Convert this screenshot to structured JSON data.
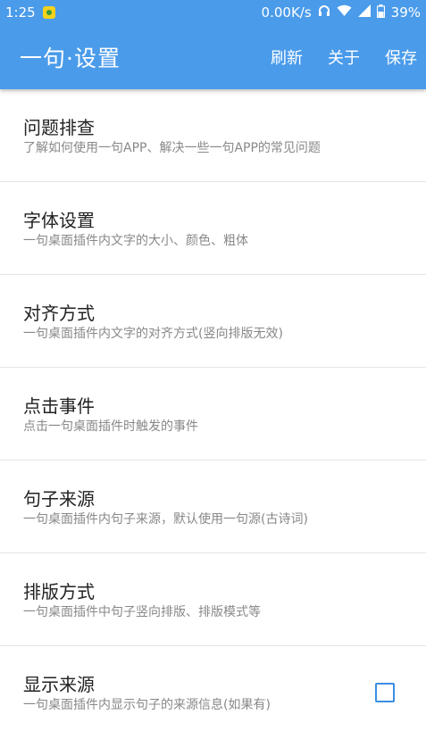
{
  "status_bar": {
    "time": "1:25",
    "speed": "0.00K/s",
    "battery": "39%"
  },
  "app_bar": {
    "title": "一句·设置",
    "actions": [
      "刷新",
      "关于",
      "保存"
    ]
  },
  "settings": [
    {
      "title": "问题排查",
      "desc": "了解如何使用一句APP、解决一些一句APP的常见问题"
    },
    {
      "title": "字体设置",
      "desc": "一句桌面插件内文字的大小、颜色、粗体"
    },
    {
      "title": "对齐方式",
      "desc": "一句桌面插件内文字的对齐方式(竖向排版无效)"
    },
    {
      "title": "点击事件",
      "desc": "点击一句桌面插件时触发的事件"
    },
    {
      "title": "句子来源",
      "desc": "一句桌面插件内句子来源，默认使用一句源(古诗词)"
    },
    {
      "title": "排版方式",
      "desc": "一句桌面插件中句子竖向排版、排版模式等"
    },
    {
      "title": "显示来源",
      "desc": "一句桌面插件内显示句子的来源信息(如果有)",
      "checked": false
    }
  ],
  "colors": {
    "primary": "#4a9bea",
    "checkbox": "#3b8ee5"
  }
}
